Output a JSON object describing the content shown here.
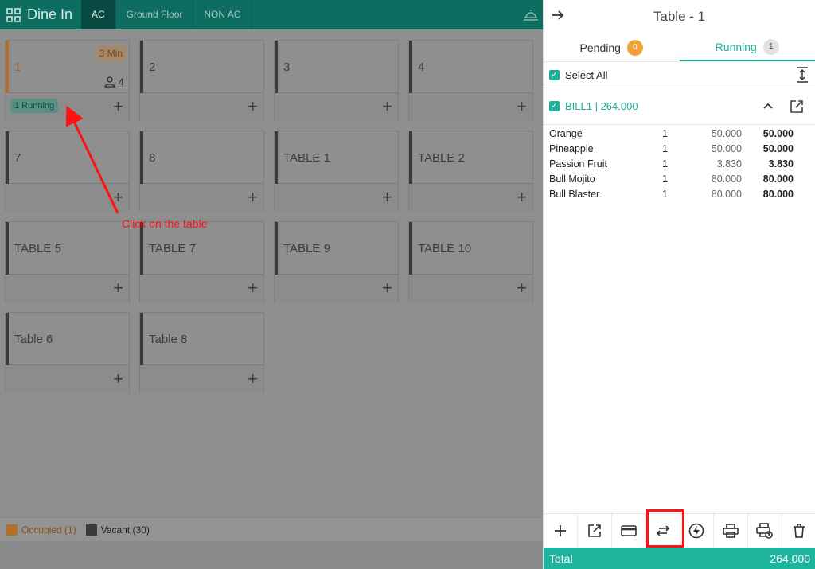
{
  "topbar": {
    "title": "Dine In",
    "tabs": [
      "AC",
      "Ground Floor",
      "NON AC"
    ]
  },
  "tables": [
    {
      "name": "1",
      "timer": "3 Min",
      "guests": "4",
      "badge": "1 Running"
    },
    {
      "name": "2"
    },
    {
      "name": "3"
    },
    {
      "name": "4"
    },
    {
      "name": "7"
    },
    {
      "name": "8"
    },
    {
      "name": "TABLE 1"
    },
    {
      "name": "TABLE 2"
    },
    {
      "name": "TABLE 5"
    },
    {
      "name": "TABLE 7"
    },
    {
      "name": "TABLE 9"
    },
    {
      "name": "TABLE 10"
    },
    {
      "name": "Table 6"
    },
    {
      "name": "Table 8"
    }
  ],
  "plus": "+",
  "legend": {
    "occupied": "Occupied (1)",
    "vacant": "Vacant (30)",
    "occupied_color": "#b2702a",
    "vacant_color": "#3a3a3a"
  },
  "annotation": "Click on the table",
  "panel": {
    "title": "Table - 1",
    "tabs": {
      "pending_label": "Pending",
      "pending_count": "0",
      "running_label": "Running",
      "running_count": "1"
    },
    "select_all": "Select All",
    "bill": "BILL1 | 264.000",
    "items": [
      {
        "name": "Orange",
        "qty": "1",
        "price": "50.000",
        "total": "50.000"
      },
      {
        "name": "Pineapple",
        "qty": "1",
        "price": "50.000",
        "total": "50.000"
      },
      {
        "name": "Passion Fruit",
        "qty": "1",
        "price": "3.830",
        "total": "3.830"
      },
      {
        "name": "Bull Mojito",
        "qty": "1",
        "price": "80.000",
        "total": "80.000"
      },
      {
        "name": "Bull Blaster",
        "qty": "1",
        "price": "80.000",
        "total": "80.000"
      }
    ],
    "actions": [
      "add-icon",
      "open-external-icon",
      "card-payment-icon",
      "transfer-icon",
      "flash-icon",
      "print-icon",
      "print-settings-icon",
      "delete-icon"
    ],
    "total_label": "Total",
    "total_value": "264.000",
    "accent": "#1db39d"
  }
}
